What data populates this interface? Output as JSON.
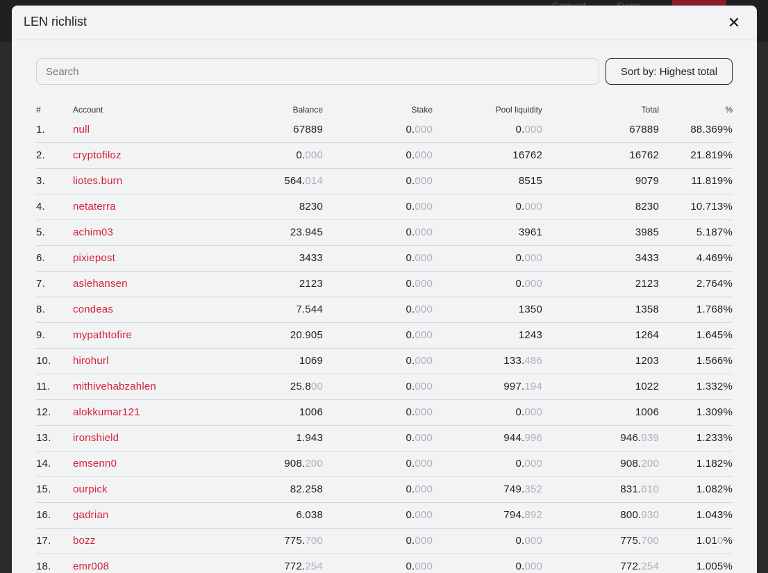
{
  "background_nav": {
    "items": [
      "Convert",
      "Swap"
    ],
    "button": ""
  },
  "modal": {
    "title": "LEN richlist",
    "close_glyph": "✕"
  },
  "search": {
    "placeholder": "Search",
    "value": ""
  },
  "sort": {
    "label": "Sort by: Highest total"
  },
  "table": {
    "columns": [
      "#",
      "Account",
      "Balance",
      "Stake",
      "Pool liquidity",
      "Total",
      "%"
    ],
    "rows": [
      {
        "rank": "1.",
        "account": "null",
        "balance": [
          "67889",
          ""
        ],
        "stake": [
          "0.",
          "000"
        ],
        "pool": [
          "0.",
          "000"
        ],
        "total": [
          "67889",
          ""
        ],
        "pct": [
          "88.369%",
          ""
        ]
      },
      {
        "rank": "2.",
        "account": "cryptofiloz",
        "balance": [
          "0.",
          "000"
        ],
        "stake": [
          "0.",
          "000"
        ],
        "pool": [
          "16762",
          ""
        ],
        "total": [
          "16762",
          ""
        ],
        "pct": [
          "21.819%",
          ""
        ]
      },
      {
        "rank": "3.",
        "account": "liotes.burn",
        "balance": [
          "564.",
          "014"
        ],
        "stake": [
          "0.",
          "000"
        ],
        "pool": [
          "8515",
          ""
        ],
        "total": [
          "9079",
          ""
        ],
        "pct": [
          "11.819%",
          ""
        ]
      },
      {
        "rank": "4.",
        "account": "netaterra",
        "balance": [
          "8230",
          ""
        ],
        "stake": [
          "0.",
          "000"
        ],
        "pool": [
          "0.",
          "000"
        ],
        "total": [
          "8230",
          ""
        ],
        "pct": [
          "10.713%",
          ""
        ]
      },
      {
        "rank": "5.",
        "account": "achim03",
        "balance": [
          "23.945",
          ""
        ],
        "stake": [
          "0.",
          "000"
        ],
        "pool": [
          "3961",
          ""
        ],
        "total": [
          "3985",
          ""
        ],
        "pct": [
          "5.187%",
          ""
        ]
      },
      {
        "rank": "6.",
        "account": "pixiepost",
        "balance": [
          "3433",
          ""
        ],
        "stake": [
          "0.",
          "000"
        ],
        "pool": [
          "0.",
          "000"
        ],
        "total": [
          "3433",
          ""
        ],
        "pct": [
          "4.469%",
          ""
        ]
      },
      {
        "rank": "7.",
        "account": "aslehansen",
        "balance": [
          "2123",
          ""
        ],
        "stake": [
          "0.",
          "000"
        ],
        "pool": [
          "0.",
          "000"
        ],
        "total": [
          "2123",
          ""
        ],
        "pct": [
          "2.764%",
          ""
        ]
      },
      {
        "rank": "8.",
        "account": "condeas",
        "balance": [
          "7.544",
          ""
        ],
        "stake": [
          "0.",
          "000"
        ],
        "pool": [
          "1350",
          ""
        ],
        "total": [
          "1358",
          ""
        ],
        "pct": [
          "1.768%",
          ""
        ]
      },
      {
        "rank": "9.",
        "account": "mypathtofire",
        "balance": [
          "20.905",
          ""
        ],
        "stake": [
          "0.",
          "000"
        ],
        "pool": [
          "1243",
          ""
        ],
        "total": [
          "1264",
          ""
        ],
        "pct": [
          "1.645%",
          ""
        ]
      },
      {
        "rank": "10.",
        "account": "hirohurl",
        "balance": [
          "1069",
          ""
        ],
        "stake": [
          "0.",
          "000"
        ],
        "pool": [
          "133.",
          "486"
        ],
        "total": [
          "1203",
          ""
        ],
        "pct": [
          "1.566%",
          ""
        ]
      },
      {
        "rank": "11.",
        "account": "mithivehabzahlen",
        "balance": [
          "25.8",
          "00"
        ],
        "stake": [
          "0.",
          "000"
        ],
        "pool": [
          "997.",
          "194"
        ],
        "total": [
          "1022",
          ""
        ],
        "pct": [
          "1.332%",
          ""
        ]
      },
      {
        "rank": "12.",
        "account": "alokkumar121",
        "balance": [
          "1006",
          ""
        ],
        "stake": [
          "0.",
          "000"
        ],
        "pool": [
          "0.",
          "000"
        ],
        "total": [
          "1006",
          ""
        ],
        "pct": [
          "1.309%",
          ""
        ]
      },
      {
        "rank": "13.",
        "account": "ironshield",
        "balance": [
          "1.943",
          ""
        ],
        "stake": [
          "0.",
          "000"
        ],
        "pool": [
          "944.",
          "996"
        ],
        "total": [
          "946.",
          "939"
        ],
        "pct": [
          "1.233%",
          ""
        ]
      },
      {
        "rank": "14.",
        "account": "emsenn0",
        "balance": [
          "908.",
          "200"
        ],
        "stake": [
          "0.",
          "000"
        ],
        "pool": [
          "0.",
          "000"
        ],
        "total": [
          "908.",
          "200"
        ],
        "pct": [
          "1.182%",
          ""
        ]
      },
      {
        "rank": "15.",
        "account": "ourpick",
        "balance": [
          "82.258",
          ""
        ],
        "stake": [
          "0.",
          "000"
        ],
        "pool": [
          "749.",
          "352"
        ],
        "total": [
          "831.",
          "610"
        ],
        "pct": [
          "1.082%",
          ""
        ]
      },
      {
        "rank": "16.",
        "account": "gadrian",
        "balance": [
          "6.038",
          ""
        ],
        "stake": [
          "0.",
          "000"
        ],
        "pool": [
          "794.",
          "892"
        ],
        "total": [
          "800.",
          "930"
        ],
        "pct": [
          "1.043%",
          ""
        ]
      },
      {
        "rank": "17.",
        "account": "bozz",
        "balance": [
          "775.",
          "700"
        ],
        "stake": [
          "0.",
          "000"
        ],
        "pool": [
          "0.",
          "000"
        ],
        "total": [
          "775.",
          "700"
        ],
        "pct": [
          "1.01",
          "0",
          "%"
        ]
      },
      {
        "rank": "18.",
        "account": "emr008",
        "balance": [
          "772.",
          "254"
        ],
        "stake": [
          "0.",
          "000"
        ],
        "pool": [
          "0.",
          "000"
        ],
        "total": [
          "772.",
          "254"
        ],
        "pct": [
          "1.005%",
          ""
        ]
      }
    ]
  }
}
